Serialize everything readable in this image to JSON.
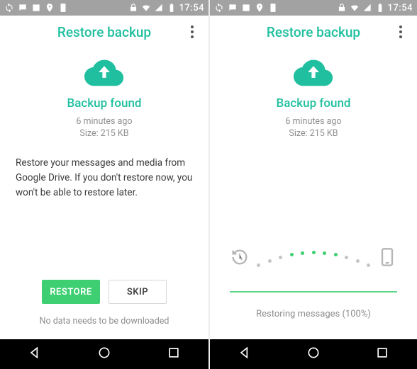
{
  "status": {
    "time": "17:54"
  },
  "header": {
    "title": "Restore backup"
  },
  "backup": {
    "found_label": "Backup found",
    "time_ago": "6 minutes ago",
    "size_line": "Size: 215 KB"
  },
  "left": {
    "description": "Restore your messages and media from Google Drive. If you don't restore now, you won't be able to restore later.",
    "restore_label": "RESTORE",
    "skip_label": "SKIP",
    "footer_note": "No data needs to be downloaded"
  },
  "right": {
    "restoring_label": "Restoring messages (100%)"
  }
}
